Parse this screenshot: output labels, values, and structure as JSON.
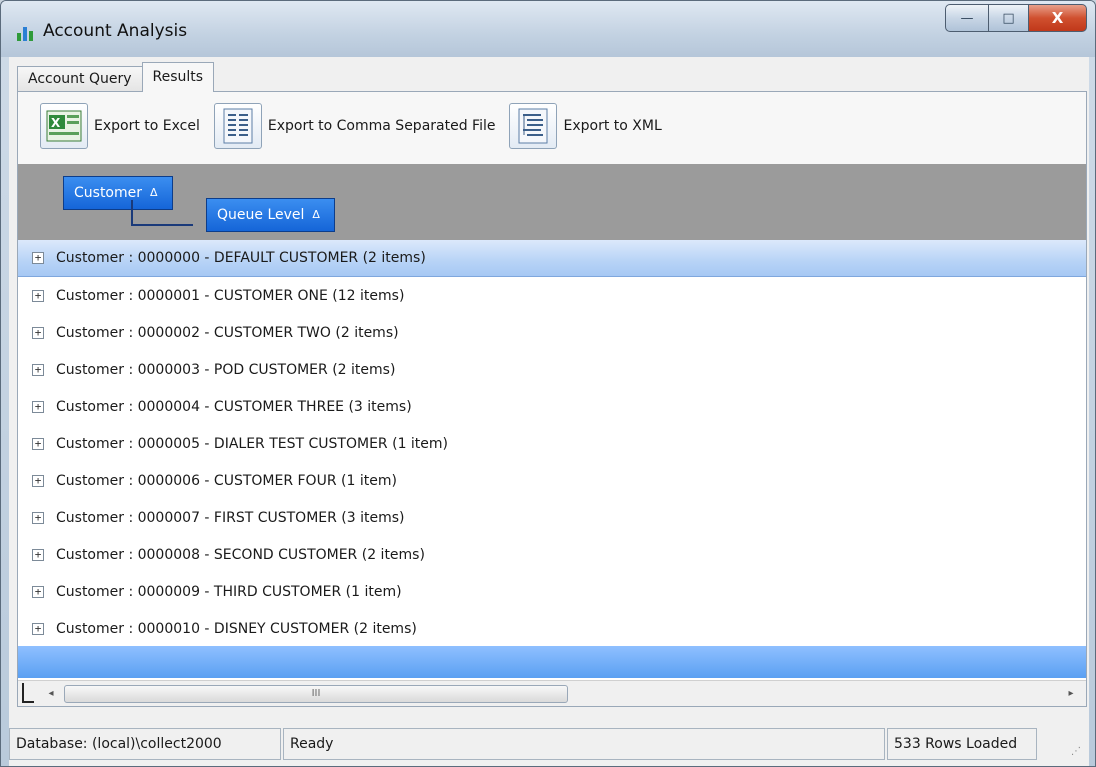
{
  "window": {
    "title": "Account Analysis",
    "icon": "bar-chart-icon",
    "controls": {
      "minimize": "—",
      "maximize": "□",
      "close": "X"
    }
  },
  "tabs": [
    {
      "label": "Account Query",
      "active": false
    },
    {
      "label": "Results",
      "active": true
    }
  ],
  "toolbar": {
    "items": [
      {
        "label": "Export to Excel",
        "icon": "excel-icon"
      },
      {
        "label": "Export to Comma Separated File",
        "icon": "csv-document-icon"
      },
      {
        "label": "Export to XML",
        "icon": "xml-document-icon"
      }
    ]
  },
  "group_by": {
    "chips": [
      {
        "label": "Customer",
        "sort": "Δ"
      },
      {
        "label": "Queue Level",
        "sort": "Δ"
      }
    ]
  },
  "grid": {
    "rows": [
      {
        "text": "Customer : 0000000 - DEFAULT CUSTOMER (2 items)",
        "selected": true
      },
      {
        "text": "Customer : 0000001 - CUSTOMER ONE (12 items)"
      },
      {
        "text": "Customer : 0000002 - CUSTOMER TWO (2 items)"
      },
      {
        "text": "Customer : 0000003 - POD CUSTOMER (2 items)"
      },
      {
        "text": "Customer : 0000004 - CUSTOMER THREE (3 items)"
      },
      {
        "text": "Customer : 0000005 - DIALER TEST CUSTOMER (1 item)"
      },
      {
        "text": "Customer : 0000006 - CUSTOMER FOUR (1 item)"
      },
      {
        "text": "Customer : 0000007 - FIRST CUSTOMER (3 items)"
      },
      {
        "text": "Customer : 0000008 - SECOND CUSTOMER (2 items)"
      },
      {
        "text": "Customer : 0000009 - THIRD CUSTOMER (1 item)"
      },
      {
        "text": "Customer : 0000010 - DISNEY CUSTOMER (2 items)"
      }
    ],
    "expander_glyph": "+"
  },
  "scrollbar": {
    "left_arrow": "◂",
    "right_arrow": "▸",
    "thumb_grip": "III"
  },
  "status": {
    "database": "Database: (local)\\collect2000",
    "state": "Ready",
    "rows_loaded": "533 Rows Loaded"
  }
}
